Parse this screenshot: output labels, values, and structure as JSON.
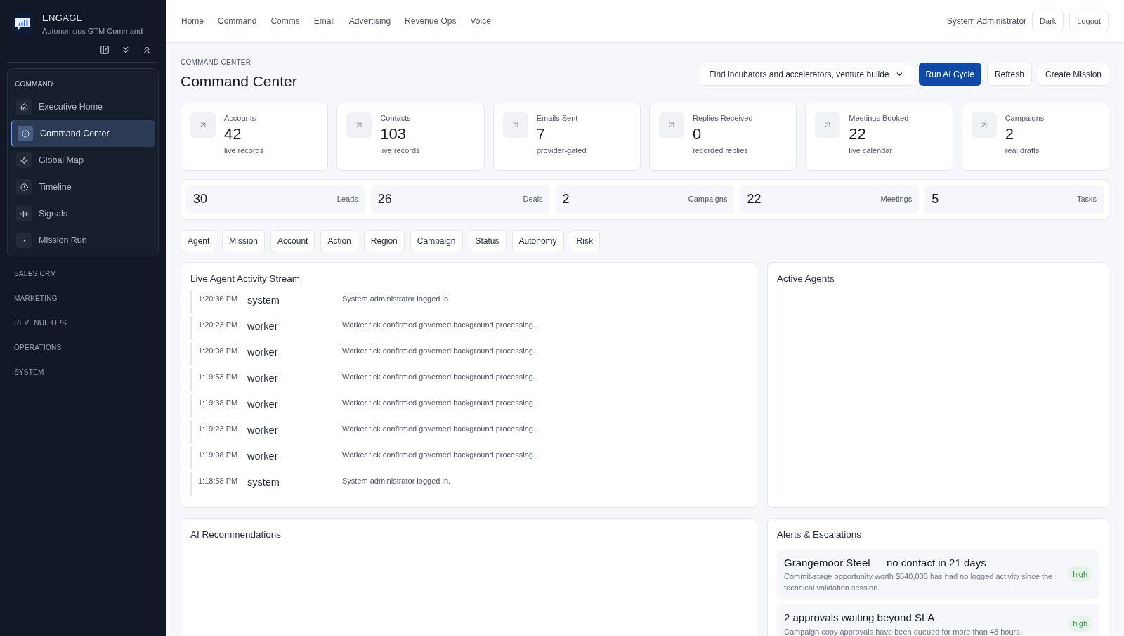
{
  "brand": {
    "name": "ENGAGE",
    "tagline": "Autonomous GTM Command"
  },
  "sidebar": {
    "sections": [
      {
        "label": "COMMAND",
        "expanded": true,
        "items": [
          {
            "label": "Executive Home",
            "selected": false
          },
          {
            "label": "Command Center",
            "selected": true
          },
          {
            "label": "Global Map",
            "selected": false
          },
          {
            "label": "Timeline",
            "selected": false
          },
          {
            "label": "Signals",
            "selected": false
          },
          {
            "label": "Mission Run",
            "selected": false
          }
        ]
      },
      {
        "label": "SALES CRM",
        "expanded": false
      },
      {
        "label": "MARKETING",
        "expanded": false
      },
      {
        "label": "REVENUE OPS",
        "expanded": false
      },
      {
        "label": "OPERATIONS",
        "expanded": false
      },
      {
        "label": "SYSTEM",
        "expanded": false
      }
    ]
  },
  "top_nav": [
    "Home",
    "Command",
    "Comms",
    "Email",
    "Advertising",
    "Revenue Ops",
    "Voice"
  ],
  "user": "System Administrator",
  "header_buttons": [
    "Dark",
    "Logout"
  ],
  "breadcrumb": "COMMAND CENTER",
  "page_title": "Command Center",
  "mission_select": {
    "value": "Find incubators and accelerators, venture builde"
  },
  "actions": [
    {
      "label": "Run AI Cycle",
      "primary": true
    },
    {
      "label": "Refresh",
      "primary": false
    },
    {
      "label": "Create Mission",
      "primary": false
    }
  ],
  "stats": [
    {
      "label": "Accounts",
      "value": "42",
      "note": "live records"
    },
    {
      "label": "Contacts",
      "value": "103",
      "note": "live records"
    },
    {
      "label": "Emails Sent",
      "value": "7",
      "note": "provider-gated"
    },
    {
      "label": "Replies Received",
      "value": "0",
      "note": "recorded replies"
    },
    {
      "label": "Meetings Booked",
      "value": "22",
      "note": "live calendar"
    },
    {
      "label": "Campaigns",
      "value": "2",
      "note": "real drafts"
    }
  ],
  "summary": [
    {
      "count": "30",
      "caption": "Leads"
    },
    {
      "count": "26",
      "caption": "Deals"
    },
    {
      "count": "2",
      "caption": "Campaigns"
    },
    {
      "count": "22",
      "caption": "Meetings"
    },
    {
      "count": "5",
      "caption": "Tasks"
    }
  ],
  "filters": [
    "Agent",
    "Mission",
    "Account",
    "Action",
    "Region",
    "Campaign",
    "Status",
    "Autonomy",
    "Risk"
  ],
  "activity": {
    "title": "Live Agent Activity Stream",
    "events": [
      {
        "time": "1:20:36 PM",
        "actor": "system",
        "message": "System administrator logged in."
      },
      {
        "time": "1:20:23 PM",
        "actor": "worker",
        "message": "Worker tick confirmed governed background processing."
      },
      {
        "time": "1:20:08 PM",
        "actor": "worker",
        "message": "Worker tick confirmed governed background processing."
      },
      {
        "time": "1:19:53 PM",
        "actor": "worker",
        "message": "Worker tick confirmed governed background processing."
      },
      {
        "time": "1:19:38 PM",
        "actor": "worker",
        "message": "Worker tick confirmed governed background processing."
      },
      {
        "time": "1:19:23 PM",
        "actor": "worker",
        "message": "Worker tick confirmed governed background processing."
      },
      {
        "time": "1:19:08 PM",
        "actor": "worker",
        "message": "Worker tick confirmed governed background processing."
      },
      {
        "time": "1:18:58 PM",
        "actor": "system",
        "message": "System administrator logged in."
      }
    ]
  },
  "active_agents": {
    "title": "Active Agents"
  },
  "recommendations": {
    "title": "AI Recommendations"
  },
  "alerts": {
    "title": "Alerts & Escalations",
    "items": [
      {
        "title": "Grangemoor Steel — no contact in 21 days",
        "description": "Commit-stage opportunity worth $540,000 has had no logged activity since the technical validation session.",
        "severity": "high"
      },
      {
        "title": "2 approvals waiting beyond SLA",
        "description": "Campaign copy approvals have been queued for more than 48 hours.",
        "severity": "high"
      }
    ]
  }
}
